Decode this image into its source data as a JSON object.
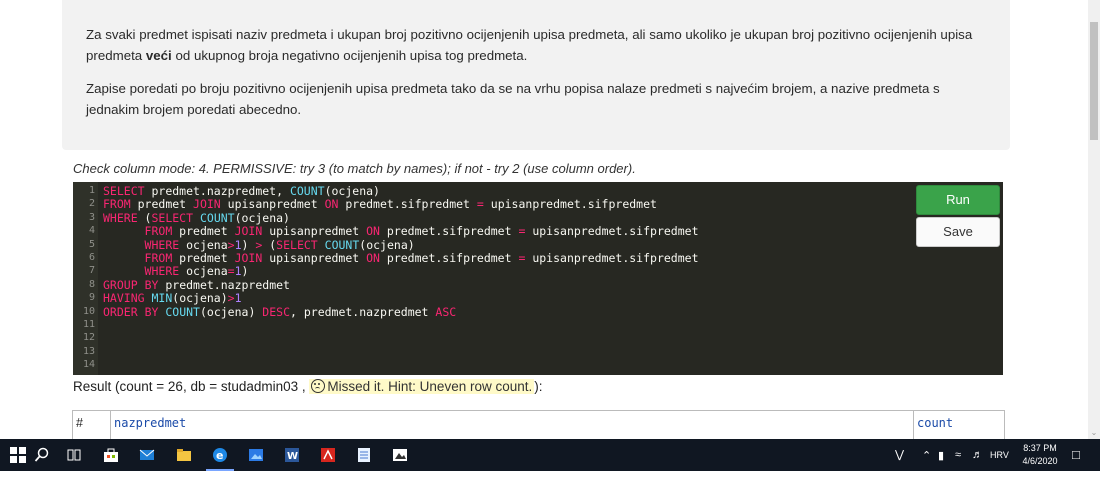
{
  "task": {
    "p1_part1": "Za svaki predmet ispisati naziv predmeta i ukupan broj pozitivno ocijenjenih upisa predmeta, ali samo ukoliko je ukupan broj pozitivno ocijenjenih upisa predmeta ",
    "p1_bold": "veći",
    "p1_part2": " od ukupnog broja negativno ocijenjenih upisa tog predmeta.",
    "p2": "Zapise poredati po broju pozitivno ocijenjenih upisa predmeta tako da se na vrhu popisa nalaze predmeti s najvećim brojem, a nazive predmeta s jednakim brojem poredati abecedno."
  },
  "check_mode": "Check column mode: 4. PERMISSIVE: try 3 (to match by names); if not - try 2 (use column order).",
  "editor": {
    "line_numbers": [
      "1",
      "2",
      "3",
      "4",
      "5",
      "6",
      "7",
      "8",
      "9",
      "10",
      "11",
      "12",
      "13",
      "14"
    ],
    "lines": [
      "SELECT predmet.nazpredmet, COUNT(ocjena)",
      "FROM predmet JOIN upisanpredmet ON predmet.sifpredmet = upisanpredmet.sifpredmet",
      "WHERE (SELECT COUNT(ocjena)",
      "      FROM predmet JOIN upisanpredmet ON predmet.sifpredmet = upisanpredmet.sifpredmet",
      "      WHERE ocjena>1) > (SELECT COUNT(ocjena)",
      "      FROM predmet JOIN upisanpredmet ON predmet.sifpredmet = upisanpredmet.sifpredmet",
      "      WHERE ocjena=1)",
      "GROUP BY predmet.nazpredmet",
      "HAVING MIN(ocjena)>1",
      "ORDER BY COUNT(ocjena) DESC, predmet.nazpredmet ASC",
      "",
      "",
      "",
      ""
    ]
  },
  "buttons": {
    "run": "Run",
    "save": "Save"
  },
  "result": {
    "prefix": "Result (count = 26, db = studadmin03 , ",
    "hint": "Missed it. Hint: Uneven row count.",
    "suffix": "):"
  },
  "result_table": {
    "columns": [
      "#",
      "nazpredmet",
      "count"
    ]
  },
  "taskbar": {
    "language": "HRV",
    "time": "8:37 PM",
    "date": "4/6/2020",
    "icons": [
      "windows-icon",
      "search-icon",
      "task-view-icon",
      "store-icon",
      "mail-icon",
      "file-explorer-icon",
      "edge-icon",
      "photos-icon",
      "word-icon",
      "acrobat-icon",
      "notepad-icon",
      "image-viewer-icon"
    ]
  },
  "colors": {
    "editor_bg": "#272822",
    "run_button": "#3aa34a",
    "taskbar": "#101722",
    "hint_bg": "#fffac8"
  }
}
